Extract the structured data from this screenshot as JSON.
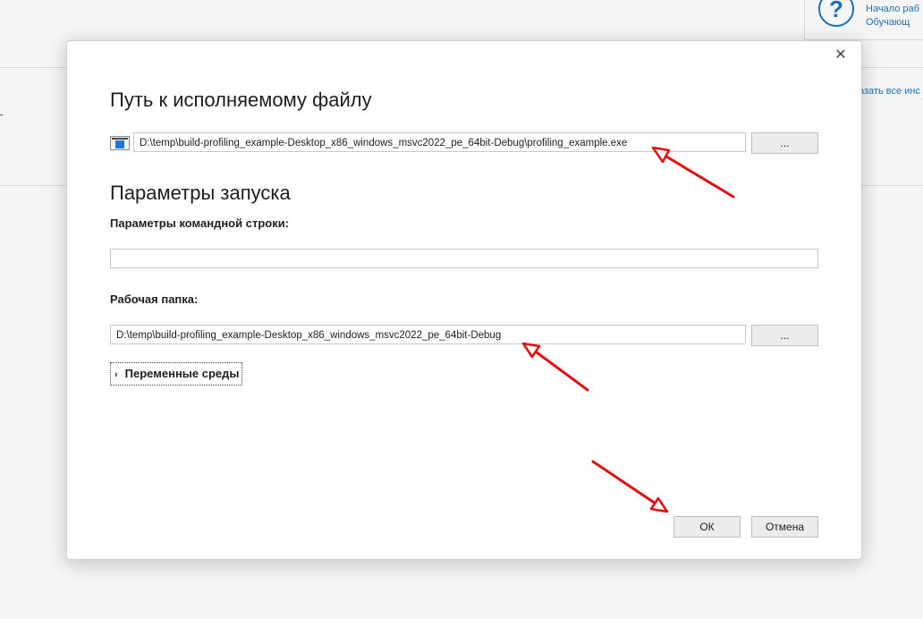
{
  "background": {
    "help_links": [
      "Начало раб",
      "Обучающ"
    ],
    "more_link": "азать все инс"
  },
  "dialog": {
    "close_symbol": "✕",
    "exe_section_title": "Путь к исполняемому файлу",
    "exe_path": "D:\\temp\\build-profiling_example-Desktop_x86_windows_msvc2022_pe_64bit-Debug\\profiling_example.exe",
    "browse_label": "...",
    "launch_section_title": "Параметры запуска",
    "cmdline_label": "Параметры командной строки:",
    "cmdline_value": "",
    "workdir_label": "Рабочая папка:",
    "workdir_value": "D:\\temp\\build-profiling_example-Desktop_x86_windows_msvc2022_pe_64bit-Debug",
    "env_label": "Переменные среды",
    "env_chevron": "›",
    "ok_label": "ОК",
    "cancel_label": "Отмена"
  },
  "annotation_color": "#e01010"
}
